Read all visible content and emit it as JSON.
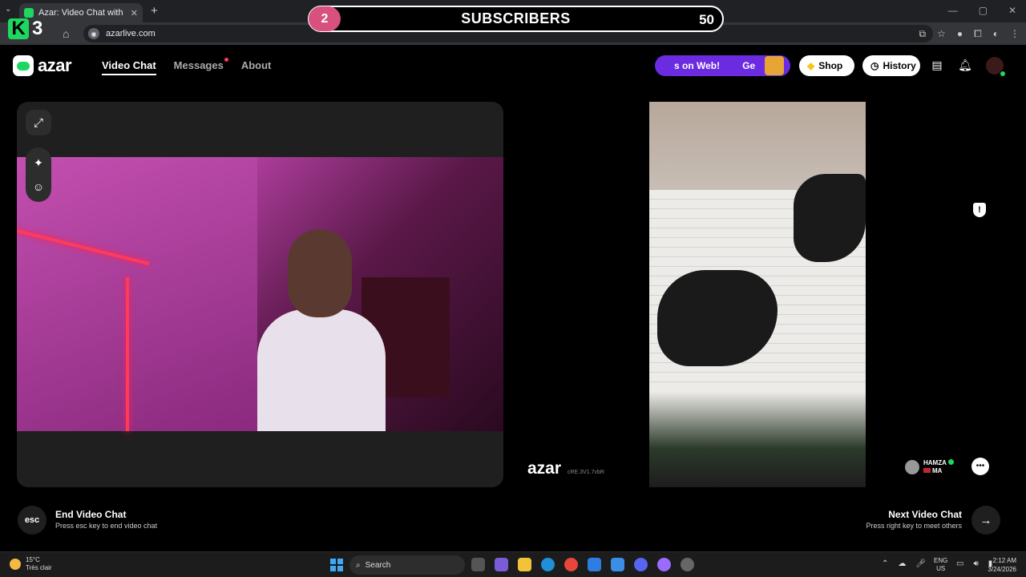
{
  "browser": {
    "tab_title": "Azar: Video Chat with New",
    "url": "azarlive.com"
  },
  "overlay": {
    "logo_text": "3",
    "sub_current": "2",
    "sub_label": "SUBSCRIBERS",
    "sub_goal": "50"
  },
  "header": {
    "logo": "azar",
    "nav": {
      "video_chat": "Video Chat",
      "messages": "Messages",
      "about": "About"
    },
    "promo_text": "s on Web!",
    "promo_cta": "Ge",
    "shop": "Shop",
    "history": "History"
  },
  "partner": {
    "watermark": "azar",
    "watermark_id": "cRE.3V1.7vbR",
    "name": "HAMZA",
    "country": "MA"
  },
  "controls": {
    "esc_label": "esc",
    "end_title": "End Video Chat",
    "end_sub": "Press esc key to end video chat",
    "next_title": "Next Video Chat",
    "next_sub": "Press right key to meet others"
  },
  "taskbar": {
    "temp": "15°C",
    "condition": "Très clair",
    "search": "Search",
    "lang_top": "ENG",
    "lang_bottom": "US",
    "time": "2:12 AM",
    "date": "3/24/2026"
  },
  "colors": {
    "accent_green": "#1ed760",
    "promo_purple": "#6b2be0",
    "sub_pink": "#d7507e"
  }
}
